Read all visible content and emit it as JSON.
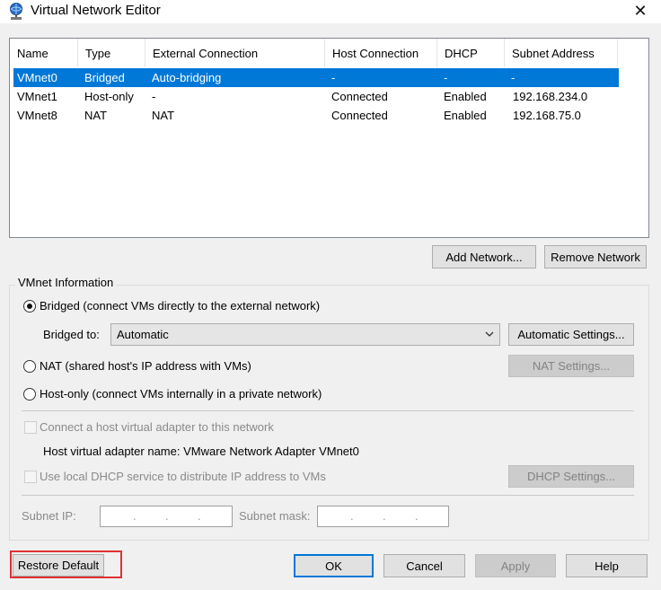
{
  "window": {
    "title": "Virtual Network Editor",
    "close_glyph": "✕"
  },
  "table": {
    "columns": [
      "Name",
      "Type",
      "External Connection",
      "Host Connection",
      "DHCP",
      "Subnet Address"
    ],
    "rows": [
      [
        "VMnet0",
        "Bridged",
        "Auto-bridging",
        "-",
        "-",
        "-"
      ],
      [
        "VMnet1",
        "Host-only",
        "-",
        "Connected",
        "Enabled",
        "192.168.234.0"
      ],
      [
        "VMnet8",
        "NAT",
        "NAT",
        "Connected",
        "Enabled",
        "192.168.75.0"
      ]
    ],
    "selected_row": 0
  },
  "list_buttons": {
    "add": "Add Network...",
    "remove": "Remove Network"
  },
  "vmnet_info": {
    "group_label": "VMnet Information",
    "bridged_label": "Bridged (connect VMs directly to the external network)",
    "bridged_to_label": "Bridged to:",
    "bridged_to_value": "Automatic",
    "automatic_settings": "Automatic Settings...",
    "nat_label": "NAT (shared host's IP address with VMs)",
    "nat_settings": "NAT Settings...",
    "hostonly_label": "Host-only (connect VMs internally in a private network)",
    "connect_adapter_label": "Connect a host virtual adapter to this network",
    "adapter_name_text": "Host virtual adapter name: VMware Network Adapter VMnet0",
    "dhcp_label": "Use local DHCP service to distribute IP address to VMs",
    "dhcp_settings": "DHCP Settings...",
    "subnet_ip_label": "Subnet IP:",
    "subnet_mask_label": "Subnet mask:",
    "ip_dot": "."
  },
  "footer": {
    "restore": "Restore Default",
    "ok": "OK",
    "cancel": "Cancel",
    "apply": "Apply",
    "help": "Help"
  },
  "colors": {
    "selection": "#0078d7",
    "highlight": "#e03030"
  }
}
